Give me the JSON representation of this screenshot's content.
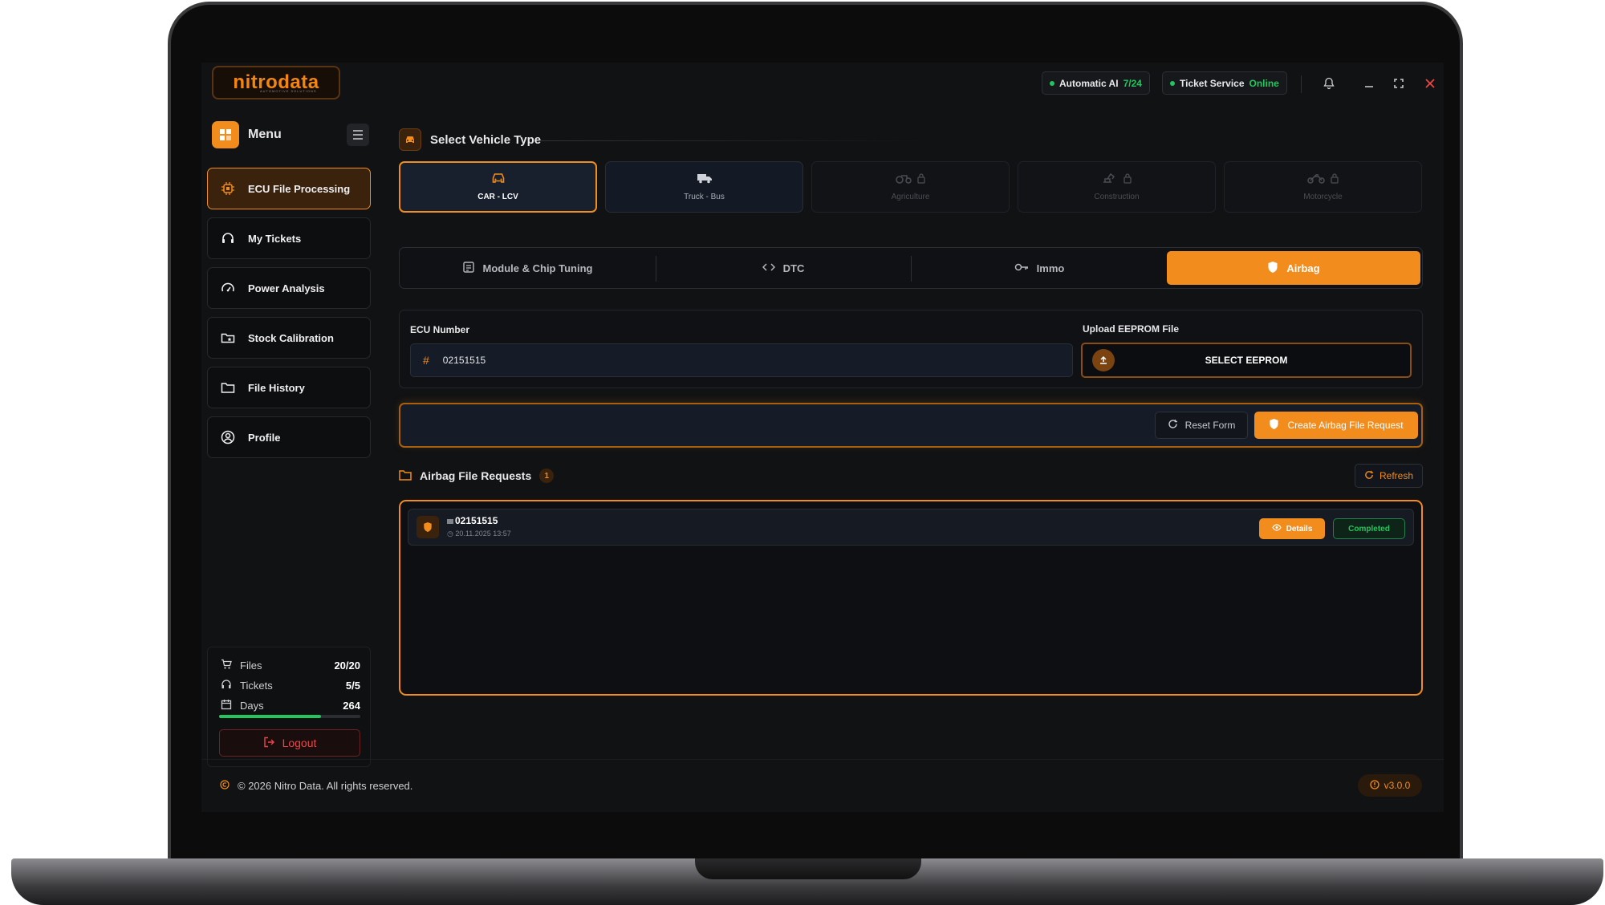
{
  "app": {
    "brand": "nitrodata",
    "brand_sub": "AUTOMOTIVE SOLUTIONS"
  },
  "topbar": {
    "auto_ai_label": "Automatic AI",
    "auto_ai_value": "7/24",
    "ticket_label": "Ticket Service",
    "ticket_value": "Online"
  },
  "sidebar": {
    "menu_title": "Menu",
    "items": [
      {
        "label": "ECU File Processing",
        "icon": "cpu-icon",
        "active": true
      },
      {
        "label": "My Tickets",
        "icon": "headset-icon"
      },
      {
        "label": "Power Analysis",
        "icon": "gauge-icon"
      },
      {
        "label": "Stock Calibration",
        "icon": "folder-star-icon"
      },
      {
        "label": "File History",
        "icon": "folder-icon"
      },
      {
        "label": "Profile",
        "icon": "user-icon"
      }
    ],
    "stats": {
      "files_label": "Files",
      "files_value": "20/20",
      "tickets_label": "Tickets",
      "tickets_value": "5/5",
      "days_label": "Days",
      "days_value": "264",
      "days_progress": 0.72
    },
    "logout_label": "Logout"
  },
  "vehicle": {
    "title": "Select Vehicle Type",
    "types": [
      {
        "label": "CAR - LCV",
        "icon": "car-icon",
        "state": "active"
      },
      {
        "label": "Truck - Bus",
        "icon": "truck-icon",
        "state": "normal"
      },
      {
        "label": "Agriculture",
        "icon": "tractor-icon",
        "state": "locked"
      },
      {
        "label": "Construction",
        "icon": "excavator-icon",
        "state": "locked"
      },
      {
        "label": "Motorcycle",
        "icon": "motorcycle-icon",
        "state": "locked"
      }
    ]
  },
  "tabs": [
    {
      "label": "Module & Chip Tuning",
      "icon": "chip-icon"
    },
    {
      "label": "DTC",
      "icon": "code-icon"
    },
    {
      "label": "Immo",
      "icon": "key-icon"
    },
    {
      "label": "Airbag",
      "icon": "shield-icon",
      "active": true
    }
  ],
  "form": {
    "ecu_label": "ECU Number",
    "ecu_value": "02151515",
    "upload_label": "Upload EEPROM File",
    "upload_button": "SELECT EEPROM",
    "reset_label": "Reset Form",
    "create_label": "Create Airbag File Request"
  },
  "requests": {
    "title": "Airbag File Requests",
    "count": "1",
    "refresh_label": "Refresh",
    "rows": [
      {
        "id": "02151515",
        "date": "20.11.2025 13:57",
        "details_label": "Details",
        "status": "Completed"
      }
    ]
  },
  "footer": {
    "copyright": "© 2026 Nitro Data. All rights reserved.",
    "version": "v3.0.0"
  },
  "colors": {
    "accent": "#f28c1c",
    "success": "#22c55e",
    "danger": "#ef4444",
    "background": "#111214"
  }
}
